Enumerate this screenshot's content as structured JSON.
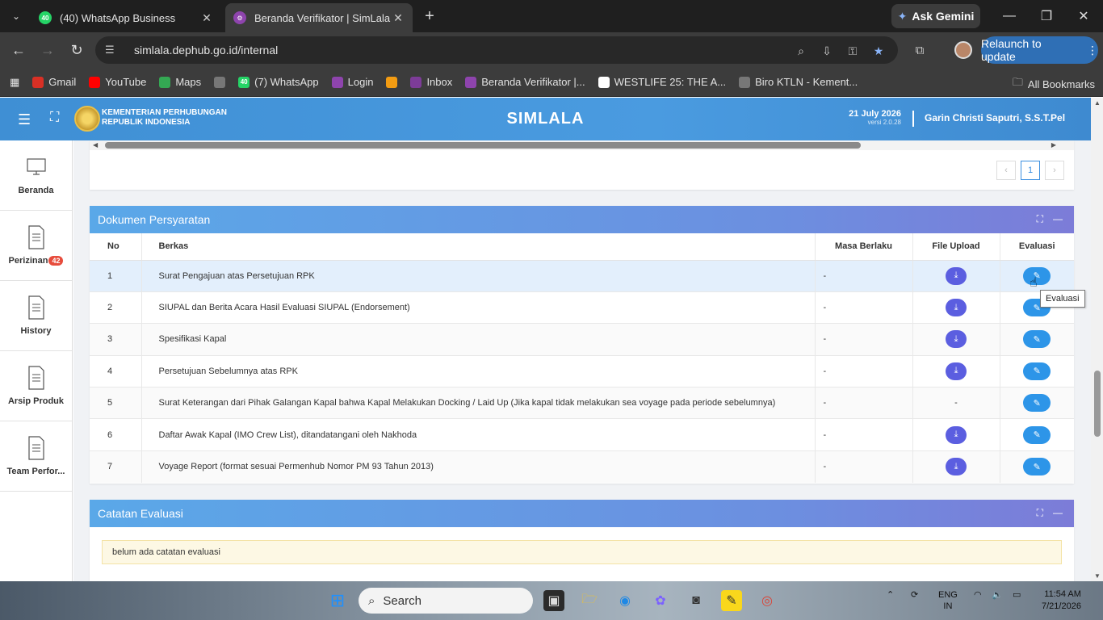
{
  "browser": {
    "tabs": [
      {
        "title": "(40) WhatsApp Business",
        "badge": "40",
        "active": false
      },
      {
        "title": "Beranda Verifikator | SimLala",
        "active": true
      }
    ],
    "gemini_label": "Ask Gemini",
    "url": "simlala.dephub.go.id/internal",
    "relaunch_label": "Relaunch to update",
    "bookmarks": [
      {
        "label": "Gmail",
        "icon": "gmail-icon",
        "color": "#d93025"
      },
      {
        "label": "YouTube",
        "icon": "youtube-icon",
        "color": "#ff0000"
      },
      {
        "label": "Maps",
        "icon": "maps-icon",
        "color": "#34a853"
      },
      {
        "label": "",
        "icon": "globe-icon",
        "color": "#777777"
      },
      {
        "label": "(7) WhatsApp",
        "icon": "whatsapp-icon",
        "color": "#25d366",
        "badge": "40"
      },
      {
        "label": "Login",
        "icon": "gear-logo-icon",
        "color": "#8e44ad"
      },
      {
        "label": "",
        "icon": "pinwheel-icon",
        "color": "#f39c12"
      },
      {
        "label": "Inbox",
        "icon": "inbox-icon",
        "color": "#7d3c98"
      },
      {
        "label": "Beranda Verifikator |...",
        "icon": "gear-logo-icon",
        "color": "#8e44ad"
      },
      {
        "label": "WESTLIFE 25: THE A...",
        "icon": "page-icon",
        "color": "#ffffff"
      },
      {
        "label": "Biro KTLN - Kement...",
        "icon": "globe-icon",
        "color": "#777777"
      }
    ],
    "all_bookmarks_label": "All Bookmarks"
  },
  "app": {
    "ministry_line1": "KEMENTERIAN PERHUBUNGAN",
    "ministry_line2": "REPUBLIK INDONESIA",
    "title": "SIMLALA",
    "date": "21 July 2026",
    "version": "versi 2.0.28",
    "user": "Garin Christi Saputri, S.S.T.Pel"
  },
  "sidebar": {
    "items": [
      {
        "label": "Beranda",
        "icon": "monitor-icon"
      },
      {
        "label": "Perizinan",
        "icon": "document-icon",
        "badge": "42"
      },
      {
        "label": "History",
        "icon": "document-icon"
      },
      {
        "label": "Arsip Produk",
        "icon": "document-icon"
      },
      {
        "label": "Team Perfor...",
        "icon": "document-icon"
      }
    ]
  },
  "pager": {
    "prev": "‹",
    "current": "1",
    "next": "›"
  },
  "dokumen": {
    "title": "Dokumen Persyaratan",
    "headers": {
      "no": "No",
      "berkas": "Berkas",
      "masa": "Masa Berlaku",
      "file": "File Upload",
      "eval": "Evaluasi"
    },
    "rows": [
      {
        "no": "1",
        "berkas": "Surat Pengajuan atas Persetujuan RPK",
        "masa": "-",
        "file": "download"
      },
      {
        "no": "2",
        "berkas": "SIUPAL dan Berita Acara Hasil Evaluasi SIUPAL (Endorsement)",
        "masa": "-",
        "file": "download"
      },
      {
        "no": "3",
        "berkas": "Spesifikasi Kapal",
        "masa": "-",
        "file": "download"
      },
      {
        "no": "4",
        "berkas": "Persetujuan Sebelumnya atas RPK",
        "masa": "-",
        "file": "download"
      },
      {
        "no": "5",
        "berkas": "Surat Keterangan dari Pihak Galangan Kapal bahwa Kapal Melakukan Docking / Laid Up (Jika kapal tidak melakukan sea voyage pada periode sebelumnya)",
        "masa": "-",
        "file": "-"
      },
      {
        "no": "6",
        "berkas": "Daftar Awak Kapal (IMO Crew List), ditandatangani oleh Nakhoda",
        "masa": "-",
        "file": "download"
      },
      {
        "no": "7",
        "berkas": "Voyage Report (format sesuai Permenhub Nomor PM 93 Tahun 2013)",
        "masa": "-",
        "file": "download"
      }
    ],
    "tooltip": "Evaluasi"
  },
  "catatan": {
    "title": "Catatan Evaluasi",
    "note": "belum ada catatan evaluasi"
  },
  "taskbar": {
    "search_placeholder": "Search",
    "lang_line1": "ENG",
    "lang_line2": "IN",
    "time": "11:54 AM",
    "date": "7/21/2026"
  }
}
